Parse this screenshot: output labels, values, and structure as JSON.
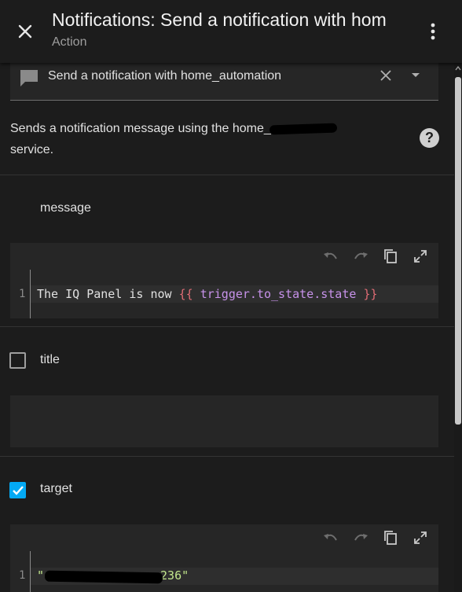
{
  "header": {
    "title": "Notifications: Send a notification with hom",
    "subtitle": "Action"
  },
  "picker": {
    "value": "Send a notification with home_automation"
  },
  "description": {
    "line1": "Sends a notification message using the home_",
    "line2": "service."
  },
  "fields": {
    "message": {
      "label": "message",
      "line_number": "1",
      "code_prefix": "The IQ Panel is now ",
      "code_open": "{{",
      "code_var": " trigger.to_state.state ",
      "code_close": "}}"
    },
    "title": {
      "label": "title",
      "checked": false
    },
    "target": {
      "label": "target",
      "checked": true,
      "line_number": "1",
      "code_open_quote": "\"",
      "code_tail": "236\""
    }
  },
  "colors": {
    "accent": "#03a9f4",
    "background": "#1c1c1c",
    "field_bg": "#262626"
  },
  "icons": {
    "close": "close-icon",
    "menu": "dots-vertical-icon",
    "picker": "message-icon",
    "clear": "clear-icon",
    "dropdown": "menu-down-icon",
    "help": "help-circle-icon",
    "undo": "undo-icon",
    "redo": "redo-icon",
    "copy": "copy-icon",
    "fullscreen": "fullscreen-icon",
    "check": "check-icon"
  }
}
